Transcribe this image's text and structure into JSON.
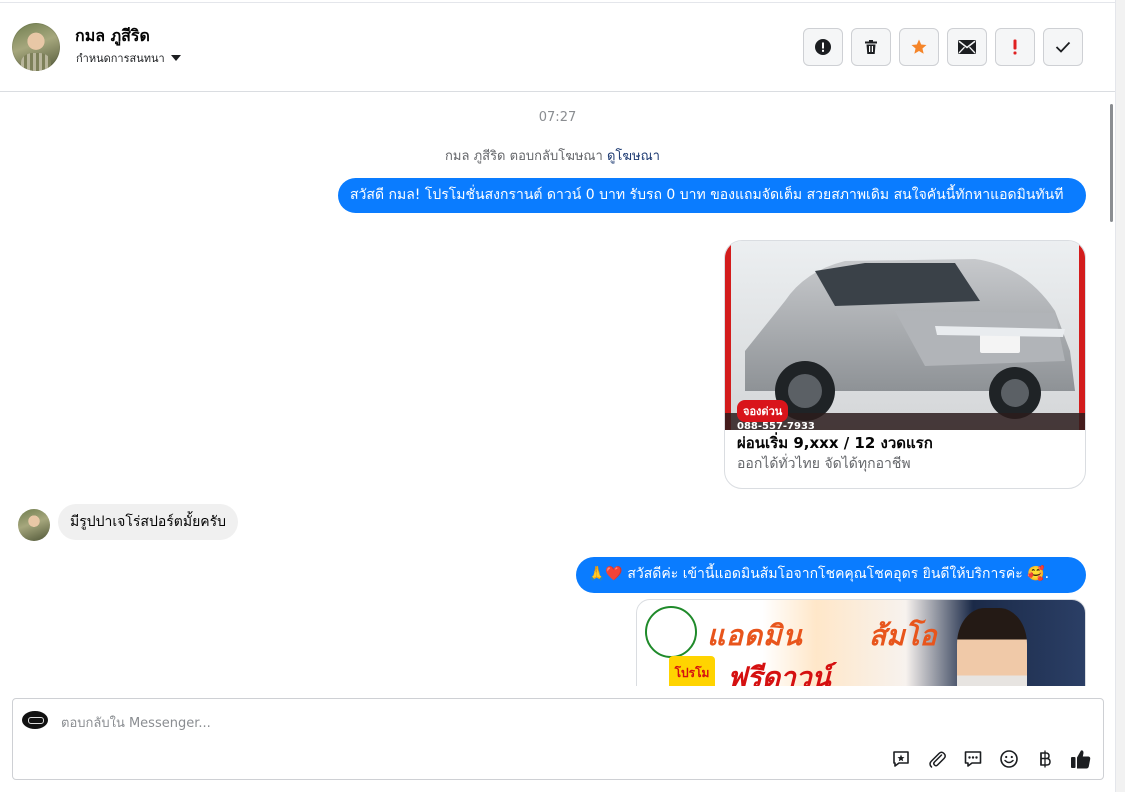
{
  "header": {
    "name": "กมล ภูสีริด",
    "subtitle": "กำหนดการสนทนา"
  },
  "toolbar": {
    "icons": [
      "alert-circle-icon",
      "trash-icon",
      "star-icon",
      "envelope-icon",
      "exclamation-icon",
      "check-icon"
    ],
    "colors": {
      "star": "#f5852a",
      "exclamation": "#e02020"
    }
  },
  "chat": {
    "time": "07:27",
    "ad_note": "กมล ภูสีริด ตอบกลับโฆษณา",
    "ad_link": "ดูโฆษณา",
    "msg1": "สวัสดี กมล! โปรโมชั่นสงกรานต์ ดาวน์ 0 บาท รับรถ 0 บาท ของแถมจัดเต็ม สวยสภาพเดิม สนใจคันนี้ทักหาแอดมินทันที",
    "card": {
      "badge": "จองด่วน",
      "phone": "088-557-7933",
      "title": "ผ่อนเริ่ม 9,xxx / 12 งวดแรก",
      "subtitle": "ออกได้ทั่วไทย จัดได้ทุกอาชีพ"
    },
    "msg2": "มีรูปปาเจโร่สปอร์ตมั้ยครับ",
    "msg3": "🙏❤️ สวัสดีค่ะ เข้านี้แอดมินส้มโอจากโชคคุณโชคอุดร ยินดีให้บริการค่ะ 🥰.",
    "banner": {
      "title_a": "แอดมิน",
      "title_b": "ส้มโอ",
      "hot": "โปรโมชั่น",
      "title_c": "ฟรีดาวน์"
    }
  },
  "composer": {
    "placeholder": "ตอบกลับใน Messenger...",
    "icons": [
      "saved-reply-icon",
      "attachment-icon",
      "chat-bubble-icon",
      "emoji-icon",
      "baht-icon",
      "thumbs-up-icon"
    ]
  },
  "colors": {
    "accent": "#0a7cff",
    "link": "#1d3a72"
  }
}
